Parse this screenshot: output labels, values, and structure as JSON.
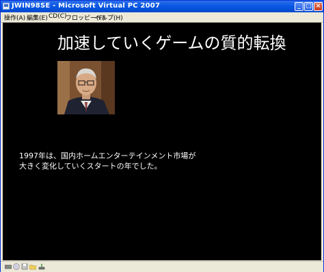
{
  "window": {
    "title": "JWIN98SE - Microsoft Virtual PC 2007"
  },
  "titlebar_buttons": {
    "minimize": "_",
    "maximize": "□",
    "close": "×"
  },
  "menu": {
    "items": [
      {
        "label": "操作(A)"
      },
      {
        "label": "編集(E)"
      },
      {
        "label": "CD(C)"
      },
      {
        "label": "フロッピー(F)"
      },
      {
        "label": "ヘルプ(H)"
      }
    ]
  },
  "slide": {
    "title": "加速していくゲームの質的転換",
    "body_line1": "1997年は、国内ホームエンターテインメント市場が",
    "body_line2": "大きく変化していくスタートの年でした。"
  },
  "statusbar": {
    "icons": [
      "disk-drive-icon",
      "cd-icon",
      "floppy-icon",
      "folder-icon",
      "network-icon"
    ]
  },
  "colors": {
    "titlebar": "#0a58e5",
    "screen": "#000000",
    "text": "#ffffff"
  }
}
